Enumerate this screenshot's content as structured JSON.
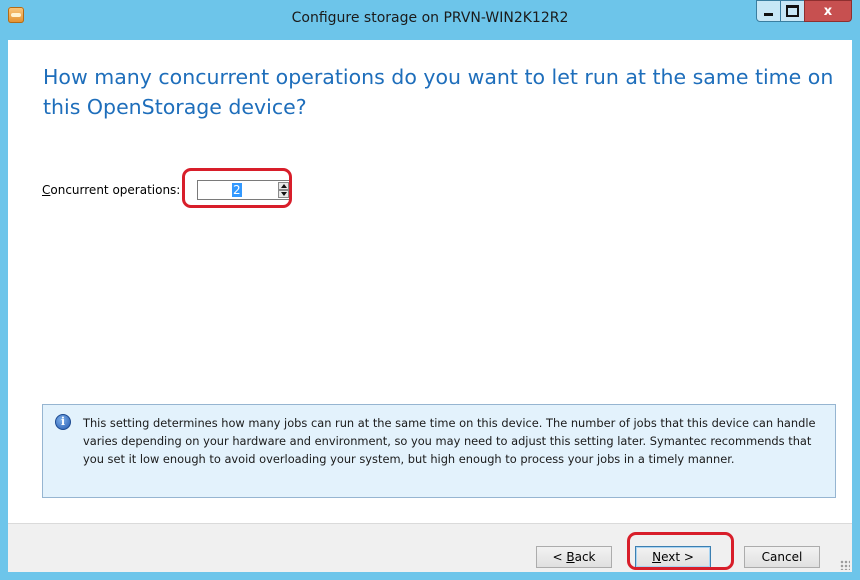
{
  "window": {
    "title": "Configure storage on PRVN-WIN2K12R2",
    "controls": {
      "minimize_icon": "minimize-icon",
      "maximize_icon": "maximize-icon",
      "close_label": "x"
    }
  },
  "page": {
    "heading": "How many concurrent operations do you want to let run at the same time on this OpenStorage device?",
    "field": {
      "label_access_key": "C",
      "label_rest": "oncurrent operations:",
      "value": "2"
    },
    "info": {
      "icon": "info-icon",
      "text": "This setting determines how many jobs can run at the same time on this device. The number of jobs that this device can handle varies depending on your hardware and environment, so you may need to adjust this setting later. Symantec recommends that you set it low enough to avoid overloading your system, but high enough to process your jobs in a timely manner."
    }
  },
  "footer": {
    "back": {
      "prefix": "< ",
      "access_key": "B",
      "rest": "ack"
    },
    "next": {
      "access_key": "N",
      "rest": "ext >"
    },
    "cancel": "Cancel"
  },
  "colors": {
    "frame": "#6dc5ea",
    "heading": "#1e6ebb",
    "highlight_ring": "#d81e2a",
    "info_background": "#e3f2fc",
    "selection": "#3399ff"
  }
}
